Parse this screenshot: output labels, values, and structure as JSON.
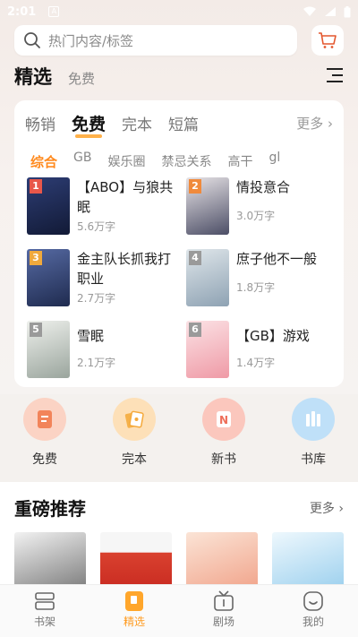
{
  "status": {
    "time": "2:01",
    "notif_icon": "A"
  },
  "search": {
    "placeholder": "热门内容/标签"
  },
  "top_tabs": {
    "active": "精选",
    "other": "免费"
  },
  "categories": [
    {
      "label": "畅销",
      "active": false
    },
    {
      "label": "免费",
      "active": true
    },
    {
      "label": "完本",
      "active": false
    },
    {
      "label": "短篇",
      "active": false
    }
  ],
  "categories_more": "更多",
  "sub_categories": [
    {
      "label": "综合",
      "active": true
    },
    {
      "label": "GB",
      "active": false
    },
    {
      "label": "娱乐圈",
      "active": false
    },
    {
      "label": "禁忌关系",
      "active": false
    },
    {
      "label": "高干",
      "active": false
    },
    {
      "label": "gl",
      "active": false
    }
  ],
  "books": [
    {
      "rank": "1",
      "title": "【ABO】与狼共眠",
      "count": "5.6万字",
      "cover_color": "#1d2a55",
      "rank_color": "#e8574a"
    },
    {
      "rank": "2",
      "title": "情投意合",
      "count": "3.0万字",
      "cover_color": "#6b6f86",
      "rank_color": "#f08a3c"
    },
    {
      "rank": "3",
      "title": "金主队长抓我打职业",
      "count": "2.7万字",
      "cover_color": "#3a4a78",
      "rank_color": "#f0a93c"
    },
    {
      "rank": "4",
      "title": "庶子他不一般",
      "count": "1.8万字",
      "cover_color": "#a9b8c4",
      "rank_color": "#9a9a9a"
    },
    {
      "rank": "5",
      "title": "雪眠",
      "count": "2.1万字",
      "cover_color": "#c5ccc7",
      "rank_color": "#9a9a9a"
    },
    {
      "rank": "6",
      "title": "【GB】游戏",
      "count": "1.4万字",
      "cover_color": "#f3b7bf",
      "rank_color": "#9a9a9a"
    }
  ],
  "entries": [
    {
      "label": "免费",
      "icon": "document-icon",
      "color": "#f7a48a"
    },
    {
      "label": "完本",
      "icon": "cards-icon",
      "color": "#f7c27a"
    },
    {
      "label": "新书",
      "icon": "new-book-icon",
      "color": "#f79a8e"
    },
    {
      "label": "书库",
      "icon": "library-icon",
      "color": "#8ec4f2"
    }
  ],
  "recommend": {
    "title": "重磅推荐",
    "more": "更多",
    "covers": [
      {
        "color": "#d9d9d9"
      },
      {
        "color": "#e25b4a"
      },
      {
        "color": "#f5d5c8"
      },
      {
        "color": "#c9e3f2"
      }
    ]
  },
  "nav": [
    {
      "label": "书架",
      "icon": "bookshelf-icon",
      "active": false
    },
    {
      "label": "精选",
      "icon": "featured-icon",
      "active": true
    },
    {
      "label": "剧场",
      "icon": "theater-icon",
      "active": false
    },
    {
      "label": "我的",
      "icon": "profile-icon",
      "active": false
    }
  ],
  "colors": {
    "accent": "#ff9a1e",
    "underline": "#ffb14a"
  }
}
